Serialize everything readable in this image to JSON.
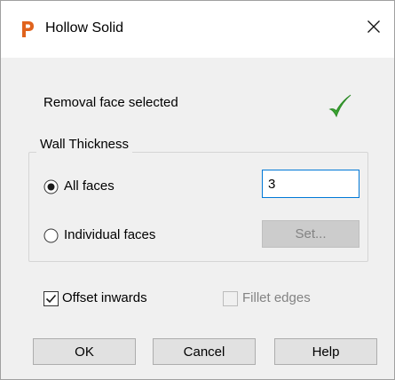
{
  "window": {
    "title": "Hollow Solid",
    "app_icon": "powermill-p-icon",
    "close_glyph": "✕"
  },
  "status": {
    "label": "Removal face selected",
    "icon": "checkmark-icon",
    "icon_color": "#3aa531"
  },
  "wall_thickness": {
    "group_title": "Wall Thickness",
    "all_faces_label": "All faces",
    "all_faces_selected": true,
    "individual_faces_label": "Individual faces",
    "individual_faces_selected": false,
    "thickness_value": "3",
    "set_button_label": "Set..."
  },
  "options": {
    "offset_inwards_label": "Offset inwards",
    "offset_inwards_checked": true,
    "fillet_edges_label": "Fillet edges",
    "fillet_edges_checked": false,
    "fillet_edges_enabled": false
  },
  "buttons": {
    "ok_label": "OK",
    "cancel_label": "Cancel",
    "help_label": "Help"
  },
  "colors": {
    "accent": "#0078d7",
    "app_icon": "#e0631d"
  }
}
